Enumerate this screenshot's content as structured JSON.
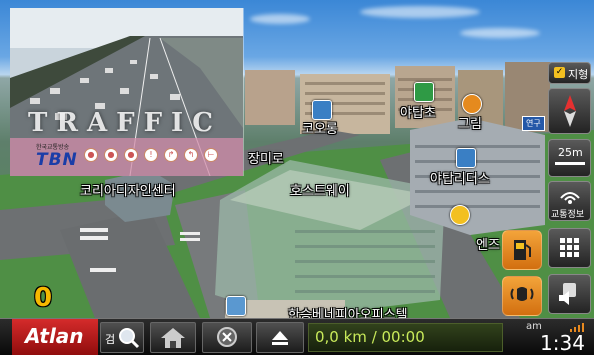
{
  "map": {
    "labels": {
      "street": "장미로",
      "poi_coolong": "코오롱",
      "poi_yatap_cho": "야탑초",
      "poi_greem": "그림",
      "poi_yatap_leaders": "야탑리더스",
      "poi_korea_design": "코리아디자인센터",
      "poi_hostway": "호스트웨이",
      "poi_hansung": "한승베네피아오피스텔",
      "poi_ents": "엔즈",
      "road_tag": "연구"
    },
    "current_speed": "0"
  },
  "traffic_cam": {
    "title": "TRAFFIC",
    "broadcaster_small": "한국교통방송",
    "broadcaster_logo": "TBN"
  },
  "right_panel": {
    "terrain_label": "지형",
    "terrain_checked": true,
    "scale_label": "25m",
    "traffic_info_label": "교통정보"
  },
  "bottom_bar": {
    "brand": "Atlan",
    "search_label": "검",
    "distance_time": "0,0 km / 00:00",
    "am_pm": "am",
    "clock": "1:34"
  },
  "colors": {
    "brand_red": "#c81e1e",
    "distance_text": "#c8ea5a",
    "speed_text": "#f6b800",
    "button_orange": "#e8891f"
  },
  "icons": [
    "compass-icon",
    "grid-menu-icon",
    "fuel-station-icon",
    "alert-speaker-icon",
    "volume-icon",
    "home-icon",
    "cancel-icon",
    "eject-icon",
    "search-icon",
    "wifi-signal-icon"
  ]
}
